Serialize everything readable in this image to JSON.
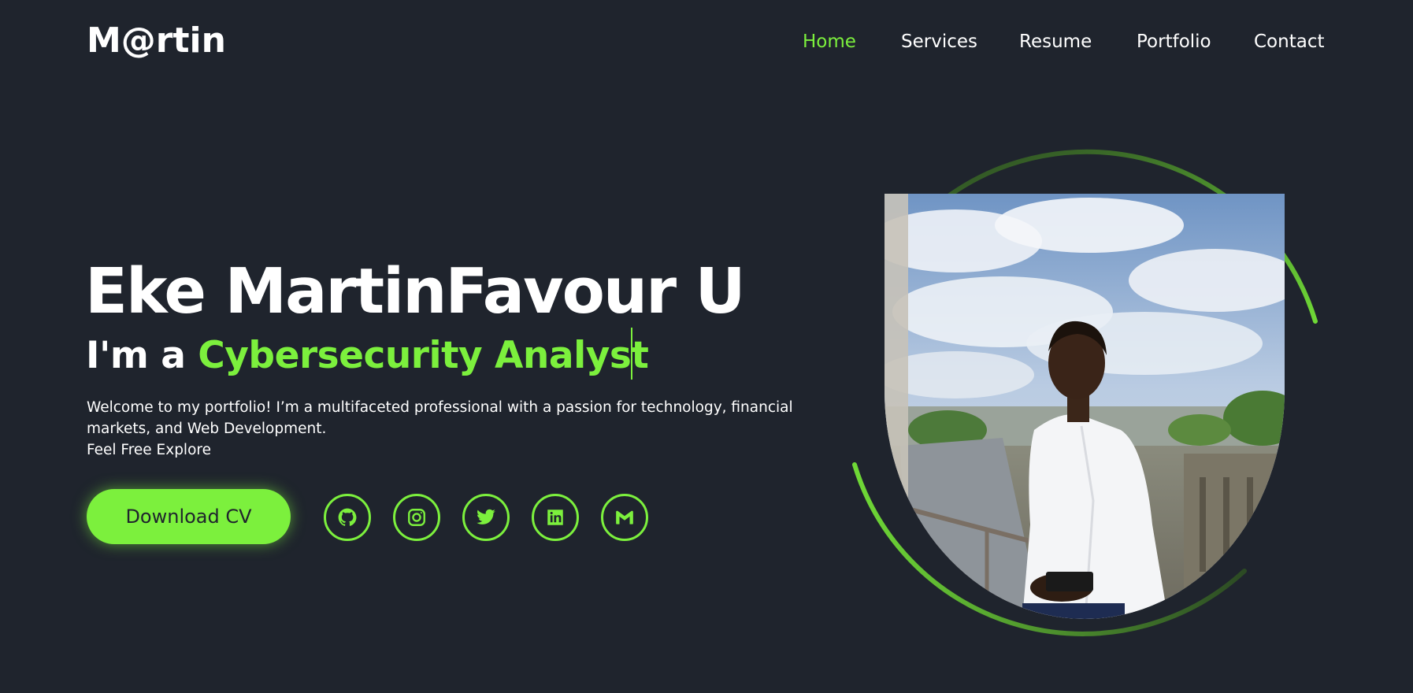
{
  "header": {
    "logo": "M@rtin",
    "nav": [
      {
        "label": "Home",
        "active": true
      },
      {
        "label": "Services",
        "active": false
      },
      {
        "label": "Resume",
        "active": false
      },
      {
        "label": "Portfolio",
        "active": false
      },
      {
        "label": "Contact",
        "active": false
      }
    ]
  },
  "hero": {
    "name": "Eke MartinFavour U",
    "subtitle_prefix": "I'm a ",
    "subtitle_role": "Cybersecurity Analyst",
    "description_lines": [
      "Welcome to my portfolio! I’m a multifaceted professional with a passion for technology, financial",
      "markets, and Web Development.",
      "Feel Free Explore"
    ],
    "cv_button": "Download CV",
    "socials": [
      "github-icon",
      "instagram-icon",
      "twitter-icon",
      "linkedin-icon",
      "gmail-icon"
    ]
  },
  "colors": {
    "background": "#1f242d",
    "accent": "#7cf03d",
    "text": "#ffffff"
  }
}
